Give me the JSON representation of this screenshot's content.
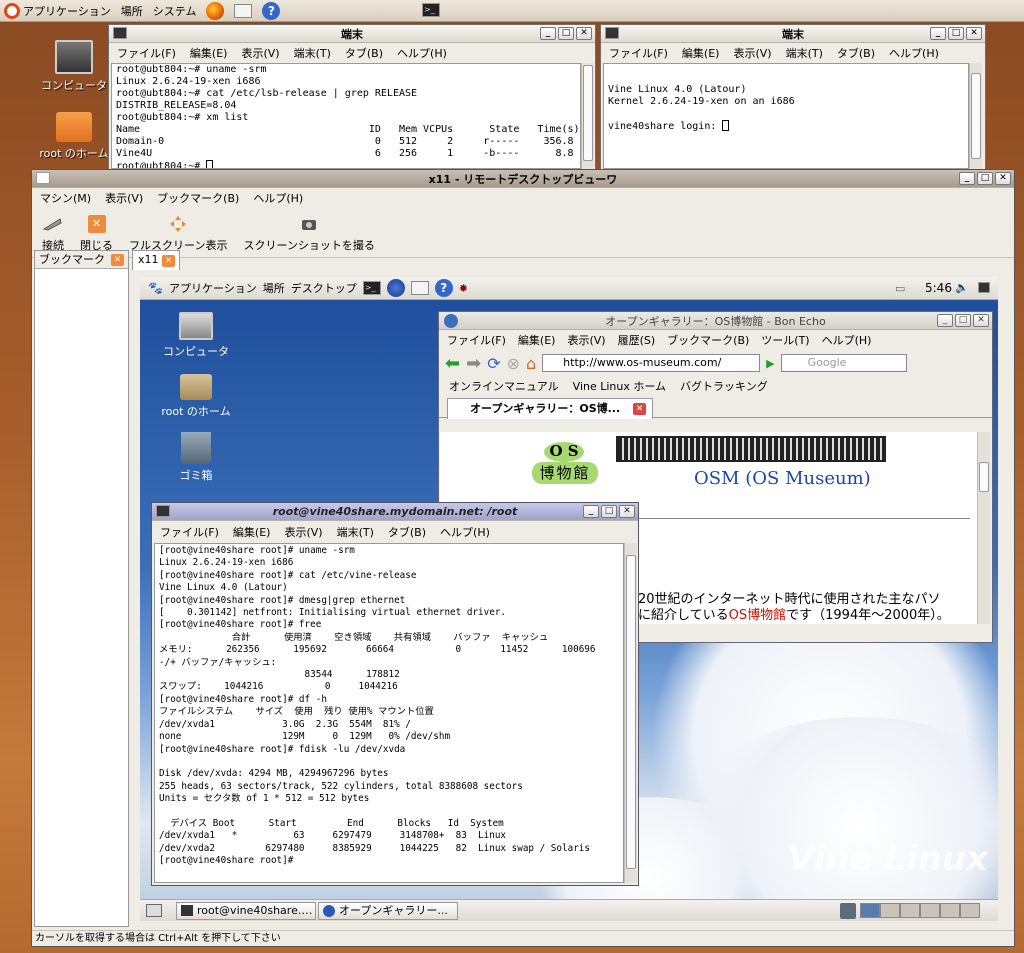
{
  "top_panel": {
    "applications": "アプリケーション",
    "places": "場所",
    "system": "システム"
  },
  "desktop": {
    "computer": "コンピュータ",
    "home": "root のホーム"
  },
  "term1": {
    "title": "端末",
    "menu": [
      "ファイル(F)",
      "編集(E)",
      "表示(V)",
      "端末(T)",
      "タブ(B)",
      "ヘルプ(H)"
    ],
    "lines": [
      "root@ubt804:~# uname -srm",
      "Linux 2.6.24-19-xen i686",
      "root@ubt804:~# cat /etc/lsb-release | grep RELEASE",
      "DISTRIB_RELEASE=8.04",
      "root@ubt804:~# xm list",
      "Name                                      ID   Mem VCPUs      State   Time(s)",
      "Domain-0                                   0   512     2     r-----    356.8",
      "Vine4U                                     6   256     1     -b----      8.8"
    ],
    "prompt": "root@ubt804:~# "
  },
  "term2": {
    "title": "端末",
    "menu": [
      "ファイル(F)",
      "編集(E)",
      "表示(V)",
      "端末(T)",
      "タブ(B)",
      "ヘルプ(H)"
    ],
    "lines": [
      "",
      "Vine Linux 4.0 (Latour)",
      "Kernel 2.6.24-19-xen on an i686",
      ""
    ],
    "prompt": "vine40share login: "
  },
  "viewer": {
    "title": "x11 - リモートデスクトップビューワ",
    "menu": [
      "マシン(M)",
      "表示(V)",
      "ブックマーク(B)",
      "ヘルプ(H)"
    ],
    "tools": [
      "接続",
      "閉じる",
      "フルスクリーン表示",
      "スクリーンショットを撮る"
    ],
    "bookmarks_label": "ブックマーク",
    "tab": "x11",
    "status": "カーソルを取得する場合は Ctrl+Alt を押下して下さい"
  },
  "remote": {
    "applications": "アプリケーション",
    "places": "場所",
    "desktop": "デスクトップ",
    "clock": "5:46",
    "icons": {
      "computer": "コンピュータ",
      "home": "root のホーム",
      "trash": "ゴミ箱"
    },
    "tasks": [
      "root@vine40share.…",
      "オープンギャラリー..."
    ],
    "watermark": "Vine Linux"
  },
  "browser": {
    "title": "オープンギャラリー：OS博物館 - Bon Echo",
    "menu": [
      "ファイル(F)",
      "編集(E)",
      "表示(V)",
      "履歴(S)",
      "ブックマーク(B)",
      "ツール(T)",
      "ヘルプ(H)"
    ],
    "url": "http://www.os-museum.com/",
    "search_placeholder": "Google",
    "bookmarks": [
      "オンラインマニュアル",
      "Vine Linux ホーム",
      "バグトラッキング"
    ],
    "tab": "オープンギャラリー：OS博...",
    "logo": {
      "os": "O S",
      "kanji": "博物館",
      "title": "OSM (OS Museum)"
    },
    "text1": "20世紀のインターネット時代に使用された主なパソ",
    "text2a": "に紹介している",
    "text2b": "OS博物館",
    "text2c": "です（1994年〜2000年）。",
    "link_color": "#cc1100"
  },
  "vterm": {
    "title": "root@vine40share.mydomain.net: /root",
    "menu": [
      "ファイル(F)",
      "編集(E)",
      "表示(V)",
      "端末(T)",
      "タブ(B)",
      "ヘルプ(H)"
    ],
    "lines": [
      "[root@vine40share root]# uname -srm",
      "Linux 2.6.24-19-xen i686",
      "[root@vine40share root]# cat /etc/vine-release",
      "Vine Linux 4.0 (Latour)",
      "[root@vine40share root]# dmesg|grep ethernet",
      "[    0.301142] netfront: Initialising virtual ethernet driver.",
      "[root@vine40share root]# free",
      "             合計      使用済    空き領域    共有領域    バッファ  キャッシュ",
      "メモリ:      262356      195692       66664           0       11452      100696",
      "-/+ バッファ/キャッシュ:",
      "                          83544      178812",
      "スワップ:    1044216           0     1044216",
      "[root@vine40share root]# df -h",
      "ファイルシステム    サイズ  使用  残り 使用% マウント位置",
      "/dev/xvda1            3.0G  2.3G  554M  81% /",
      "none                  129M     0  129M   0% /dev/shm",
      "[root@vine40share root]# fdisk -lu /dev/xvda",
      "",
      "Disk /dev/xvda: 4294 MB, 4294967296 bytes",
      "255 heads, 63 sectors/track, 522 cylinders, total 8388608 sectors",
      "Units = セクタ数 of 1 * 512 = 512 bytes",
      "",
      "  デバイス Boot      Start         End      Blocks   Id  System",
      "/dev/xvda1   *          63     6297479     3148708+  83  Linux",
      "/dev/xvda2         6297480     8385929     1044225   82  Linux swap / Solaris",
      "[root@vine40share root]# "
    ]
  }
}
